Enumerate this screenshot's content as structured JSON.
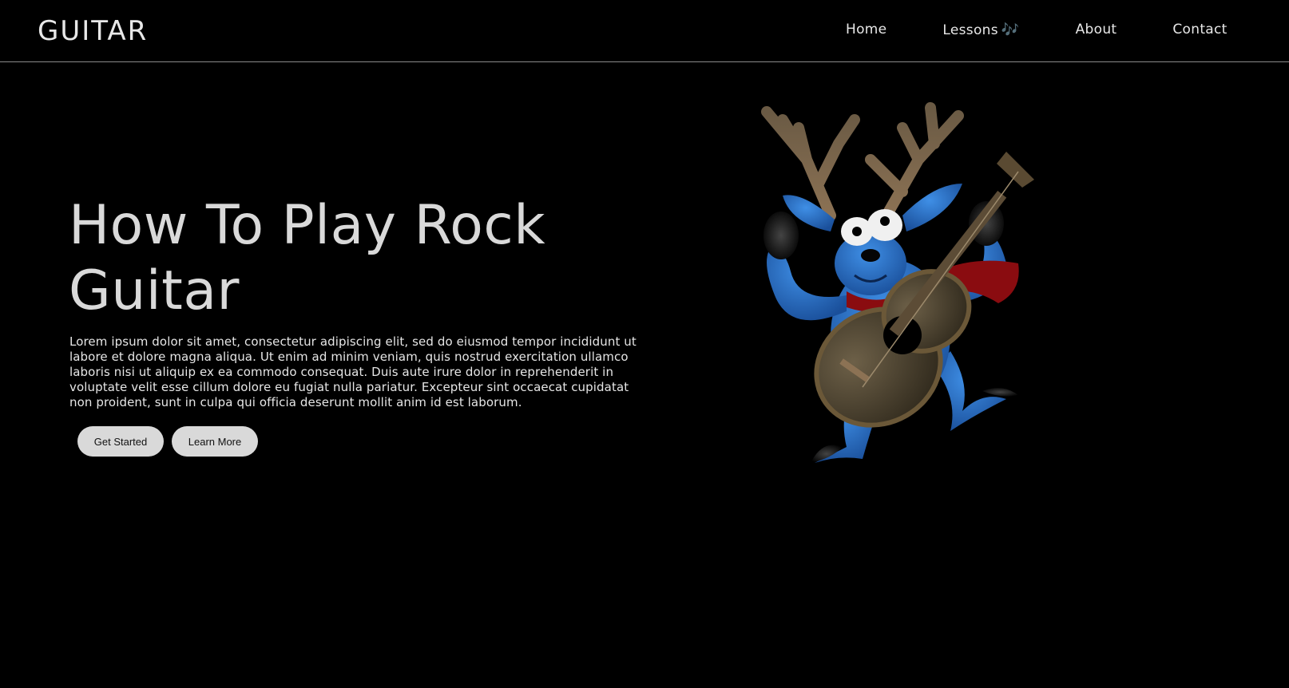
{
  "header": {
    "logo": "GUITAR",
    "nav": [
      {
        "label": "Home"
      },
      {
        "label": "Lessons",
        "icon": "music-note-icon",
        "icon_glyph": "🎶"
      },
      {
        "label": "About"
      },
      {
        "label": "Contact"
      }
    ]
  },
  "hero": {
    "title": "How To Play Rock Guitar",
    "text": "Lorem ipsum dolor sit amet, consectetur adipiscing elit, sed do eiusmod tempor incididunt ut labore et dolore magna aliqua. Ut enim ad minim veniam, quis nostrud exercitation ullamco laboris nisi ut aliquip ex ea commodo consequat. Duis aute irure dolor in reprehenderit in voluptate velit esse cillum dolore eu fugiat nulla pariatur. Excepteur sint occaecat cupidatat non proident, sunt in culpa qui officia deserunt mollit anim id est laborum.",
    "buttons": {
      "primary": "Get Started",
      "secondary": "Learn More"
    },
    "illustration": "reindeer-playing-guitar"
  },
  "colors": {
    "background": "#000000",
    "text": "#e6e6e6",
    "button_bg": "#d9d9d9",
    "button_text": "#111111",
    "divider": "#8a8a8a"
  }
}
